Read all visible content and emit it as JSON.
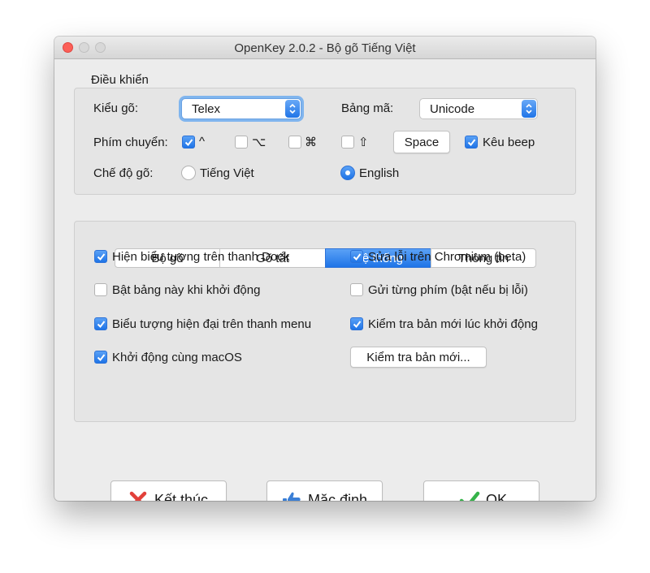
{
  "window": {
    "title": "OpenKey 2.0.2 - Bộ gõ Tiếng Việt"
  },
  "control": {
    "group_label": "Điều khiển",
    "input_method_label": "Kiểu gõ:",
    "input_method_value": "Telex",
    "charset_label": "Bảng mã:",
    "charset_value": "Unicode",
    "switch_key_label": "Phím chuyển:",
    "switch_keys": [
      {
        "symbol": "^",
        "checked": true
      },
      {
        "symbol": "⌥",
        "checked": false
      },
      {
        "symbol": "⌘",
        "checked": false
      },
      {
        "symbol": "⇧",
        "checked": false
      }
    ],
    "space_button": "Space",
    "beep_label": "Kêu beep",
    "beep_checked": true,
    "mode_label": "Chế độ gõ:",
    "mode_vietnamese": "Tiếng Việt",
    "mode_english": "English",
    "mode_selected": "English"
  },
  "tabs": [
    {
      "label": "Bộ gõ",
      "active": false
    },
    {
      "label": "Gõ tắt",
      "active": false
    },
    {
      "label": "Hệ thống",
      "active": true
    },
    {
      "label": "Thông tin",
      "active": false
    }
  ],
  "system": {
    "show_dock_icon": {
      "label": "Hiện biểu tượng trên thanh Dock",
      "checked": true
    },
    "show_on_startup": {
      "label": "Bật bảng này khi khởi động",
      "checked": false
    },
    "modern_menu_icon": {
      "label": "Biểu tượng hiện đại trên thanh menu",
      "checked": true
    },
    "launch_at_login": {
      "label": "Khởi động cùng macOS",
      "checked": true
    },
    "fix_chromium": {
      "label": "Sửa lỗi trên Chromium (beta)",
      "checked": true
    },
    "send_each_key": {
      "label": "Gửi từng phím (bật nếu bị lỗi)",
      "checked": false
    },
    "check_update_startup": {
      "label": "Kiểm tra bản mới lúc khởi động",
      "checked": true
    },
    "check_update_button": "Kiểm tra bản mới..."
  },
  "footer": {
    "quit_label": "Kết thúc",
    "default_label": "Mặc định",
    "ok_label": "OK"
  },
  "colors": {
    "accent": "#1f74e7",
    "close_red": "#fc5f57",
    "quit_icon": "#e2403a",
    "ok_icon": "#36b34a",
    "thumb_icon": "#3b7fd6"
  }
}
